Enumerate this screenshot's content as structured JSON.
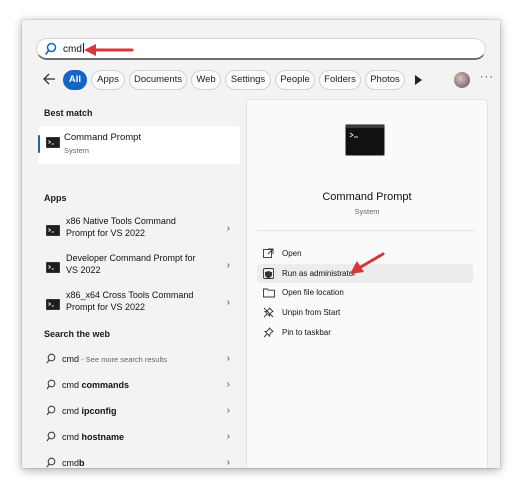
{
  "search": {
    "value": "cmd"
  },
  "filters": {
    "chips": [
      "All",
      "Apps",
      "Documents",
      "Web",
      "Settings",
      "People",
      "Folders",
      "Photos"
    ],
    "active": "All"
  },
  "best_match": {
    "heading": "Best match",
    "title": "Command Prompt",
    "subtitle": "System"
  },
  "apps": {
    "heading": "Apps",
    "items": [
      {
        "line1": "x86 Native Tools Command",
        "line2": "Prompt for VS 2022"
      },
      {
        "line1": "Developer Command Prompt for",
        "line2": "VS 2022"
      },
      {
        "line1": "x86_x64 Cross Tools Command",
        "line2": "Prompt for VS 2022"
      }
    ]
  },
  "web": {
    "heading": "Search the web",
    "items": [
      {
        "prefix": "cmd",
        "bold": "",
        "suffix": " - See more search results"
      },
      {
        "prefix": "cmd ",
        "bold": "commands",
        "suffix": ""
      },
      {
        "prefix": "cmd ",
        "bold": "ipconfig",
        "suffix": ""
      },
      {
        "prefix": "cmd ",
        "bold": "hostname",
        "suffix": ""
      },
      {
        "prefix": "cmd",
        "bold": "b",
        "suffix": ""
      }
    ]
  },
  "details": {
    "title": "Command Prompt",
    "subtitle": "System",
    "actions": [
      "Open",
      "Run as administrator",
      "Open file location",
      "Unpin from Start",
      "Pin to taskbar"
    ],
    "highlighted_action": "Run as administrator"
  },
  "colors": {
    "accent": "#1565c8",
    "annotation_arrow": "#d9363a"
  }
}
